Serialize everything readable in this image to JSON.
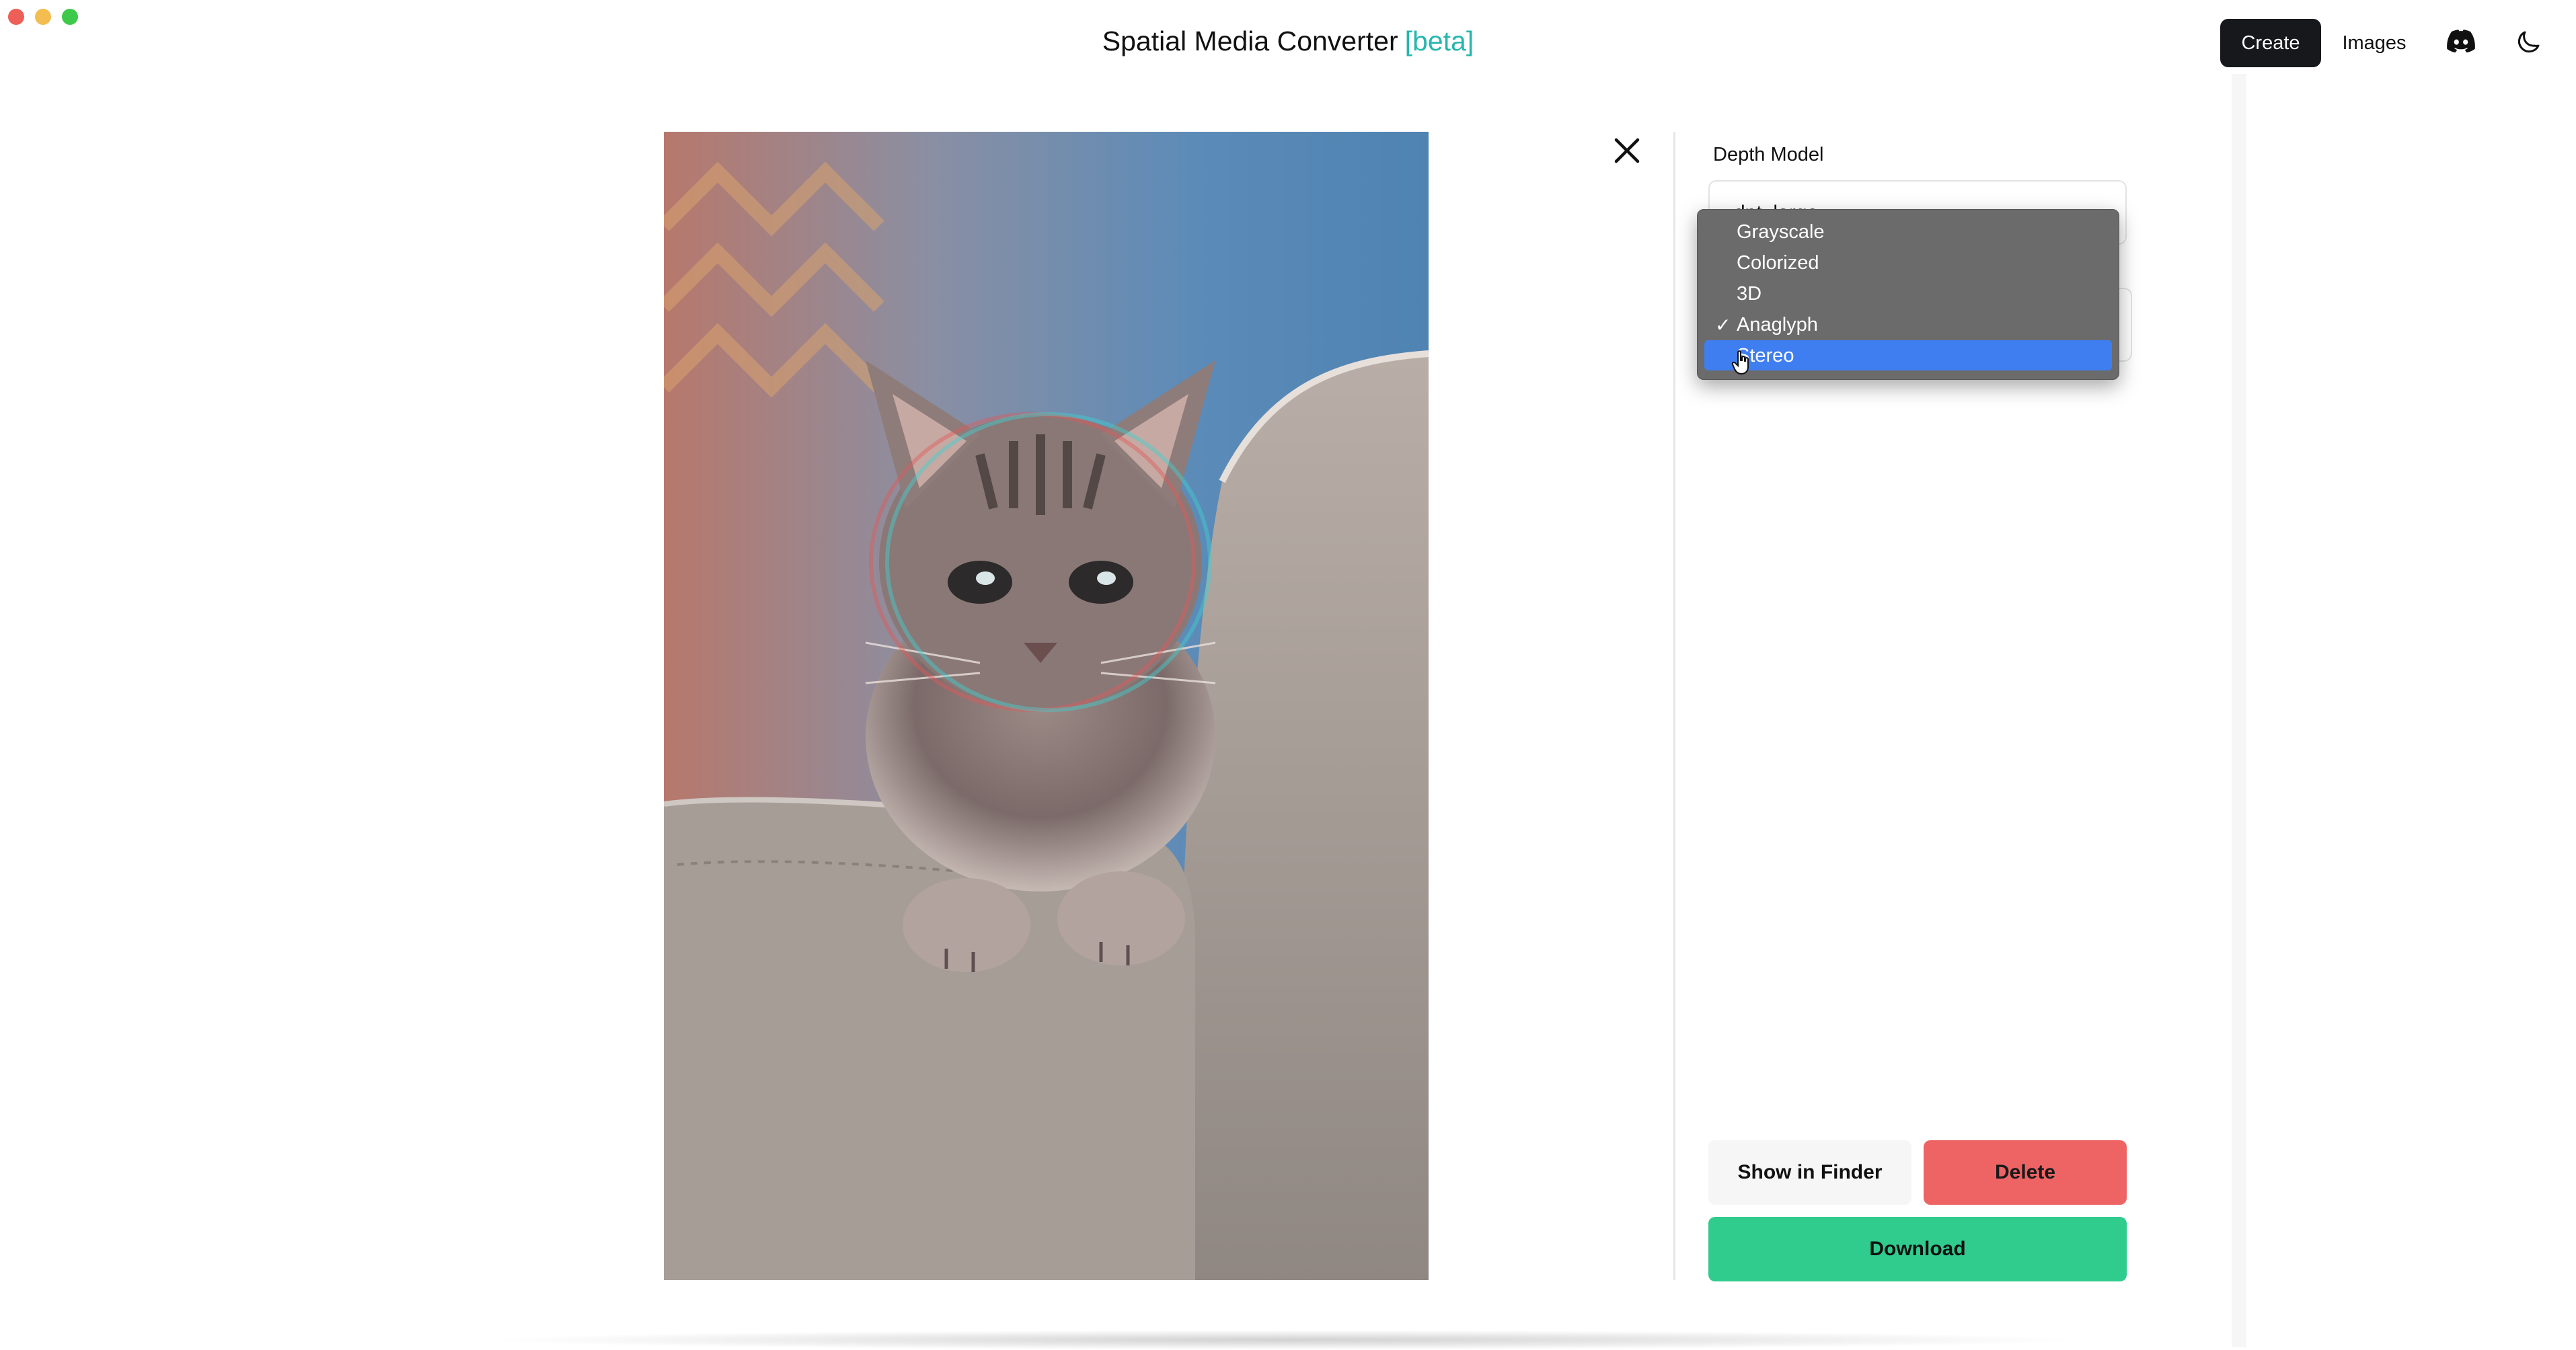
{
  "window": {
    "title": "Spatial Media Converter",
    "title_tag": "[beta]"
  },
  "nav": {
    "create_label": "Create",
    "images_label": "Images",
    "discord_icon": "discord-icon",
    "theme_icon": "moon-icon"
  },
  "preview": {
    "image_description_icon": "kitten-anaglyph-photo",
    "close_icon": "close-icon"
  },
  "panel": {
    "depth_model_label": "Depth Model",
    "depth_model_value": "dpt_large"
  },
  "output_menu": {
    "items": [
      {
        "label": "Grayscale",
        "checked": false,
        "highlighted": false
      },
      {
        "label": "Colorized",
        "checked": false,
        "highlighted": false
      },
      {
        "label": "3D",
        "checked": false,
        "highlighted": false
      },
      {
        "label": "Anaglyph",
        "checked": true,
        "highlighted": false
      },
      {
        "label": "Stereo",
        "checked": false,
        "highlighted": true
      }
    ],
    "check_glyph": "✓"
  },
  "actions": {
    "show_in_finder": "Show in Finder",
    "delete": "Delete",
    "download": "Download"
  },
  "colors": {
    "accent_teal": "#27b6ad",
    "delete_red": "#ee6465",
    "download_green": "#2fcc8e",
    "menu_highlight": "#3f7ef0"
  }
}
